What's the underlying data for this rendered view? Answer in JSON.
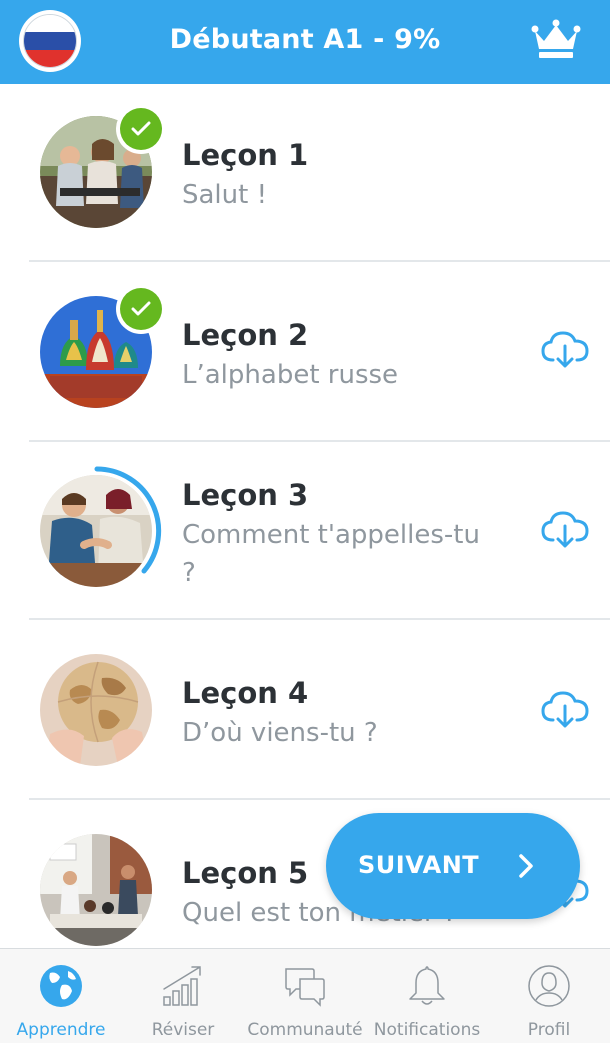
{
  "header": {
    "title": "Débutant A1 - 9%",
    "flag_colors": [
      "#ffffff",
      "#2a4fa8",
      "#e0322d"
    ],
    "color": "#36a7ec"
  },
  "lessons": [
    {
      "title": "Leçon 1",
      "subtitle": "Salut !",
      "completed": true,
      "download": false,
      "image": "people-cafe-photo"
    },
    {
      "title": "Leçon 2",
      "subtitle": "L’alphabet russe",
      "completed": true,
      "download": true,
      "image": "onion-domes-photo"
    },
    {
      "title": "Leçon 3",
      "subtitle": "Comment t'appelles-tu ?",
      "completed": false,
      "in_progress": true,
      "download": true,
      "image": "handshake-photo"
    },
    {
      "title": "Leçon 4",
      "subtitle": "D’où viens-tu ?",
      "completed": false,
      "download": true,
      "image": "globe-photo"
    },
    {
      "title": "Leçon 5",
      "subtitle": "Quel est ton métier ?",
      "completed": false,
      "download": true,
      "image": "office-meeting-photo"
    }
  ],
  "next_button": {
    "label": "SUIVANT"
  },
  "tabbar": {
    "tabs": [
      {
        "label": "Apprendre",
        "icon": "globe-icon",
        "active": true
      },
      {
        "label": "Réviser",
        "icon": "bar-chart-icon",
        "active": false
      },
      {
        "label": "Communauté",
        "icon": "chat-bubbles-icon",
        "active": false
      },
      {
        "label": "Notifications",
        "icon": "bell-icon",
        "active": false
      },
      {
        "label": "Profil",
        "icon": "profile-icon",
        "active": false
      }
    ],
    "active_color": "#36a7ec",
    "inactive_color": "#8f979e"
  }
}
